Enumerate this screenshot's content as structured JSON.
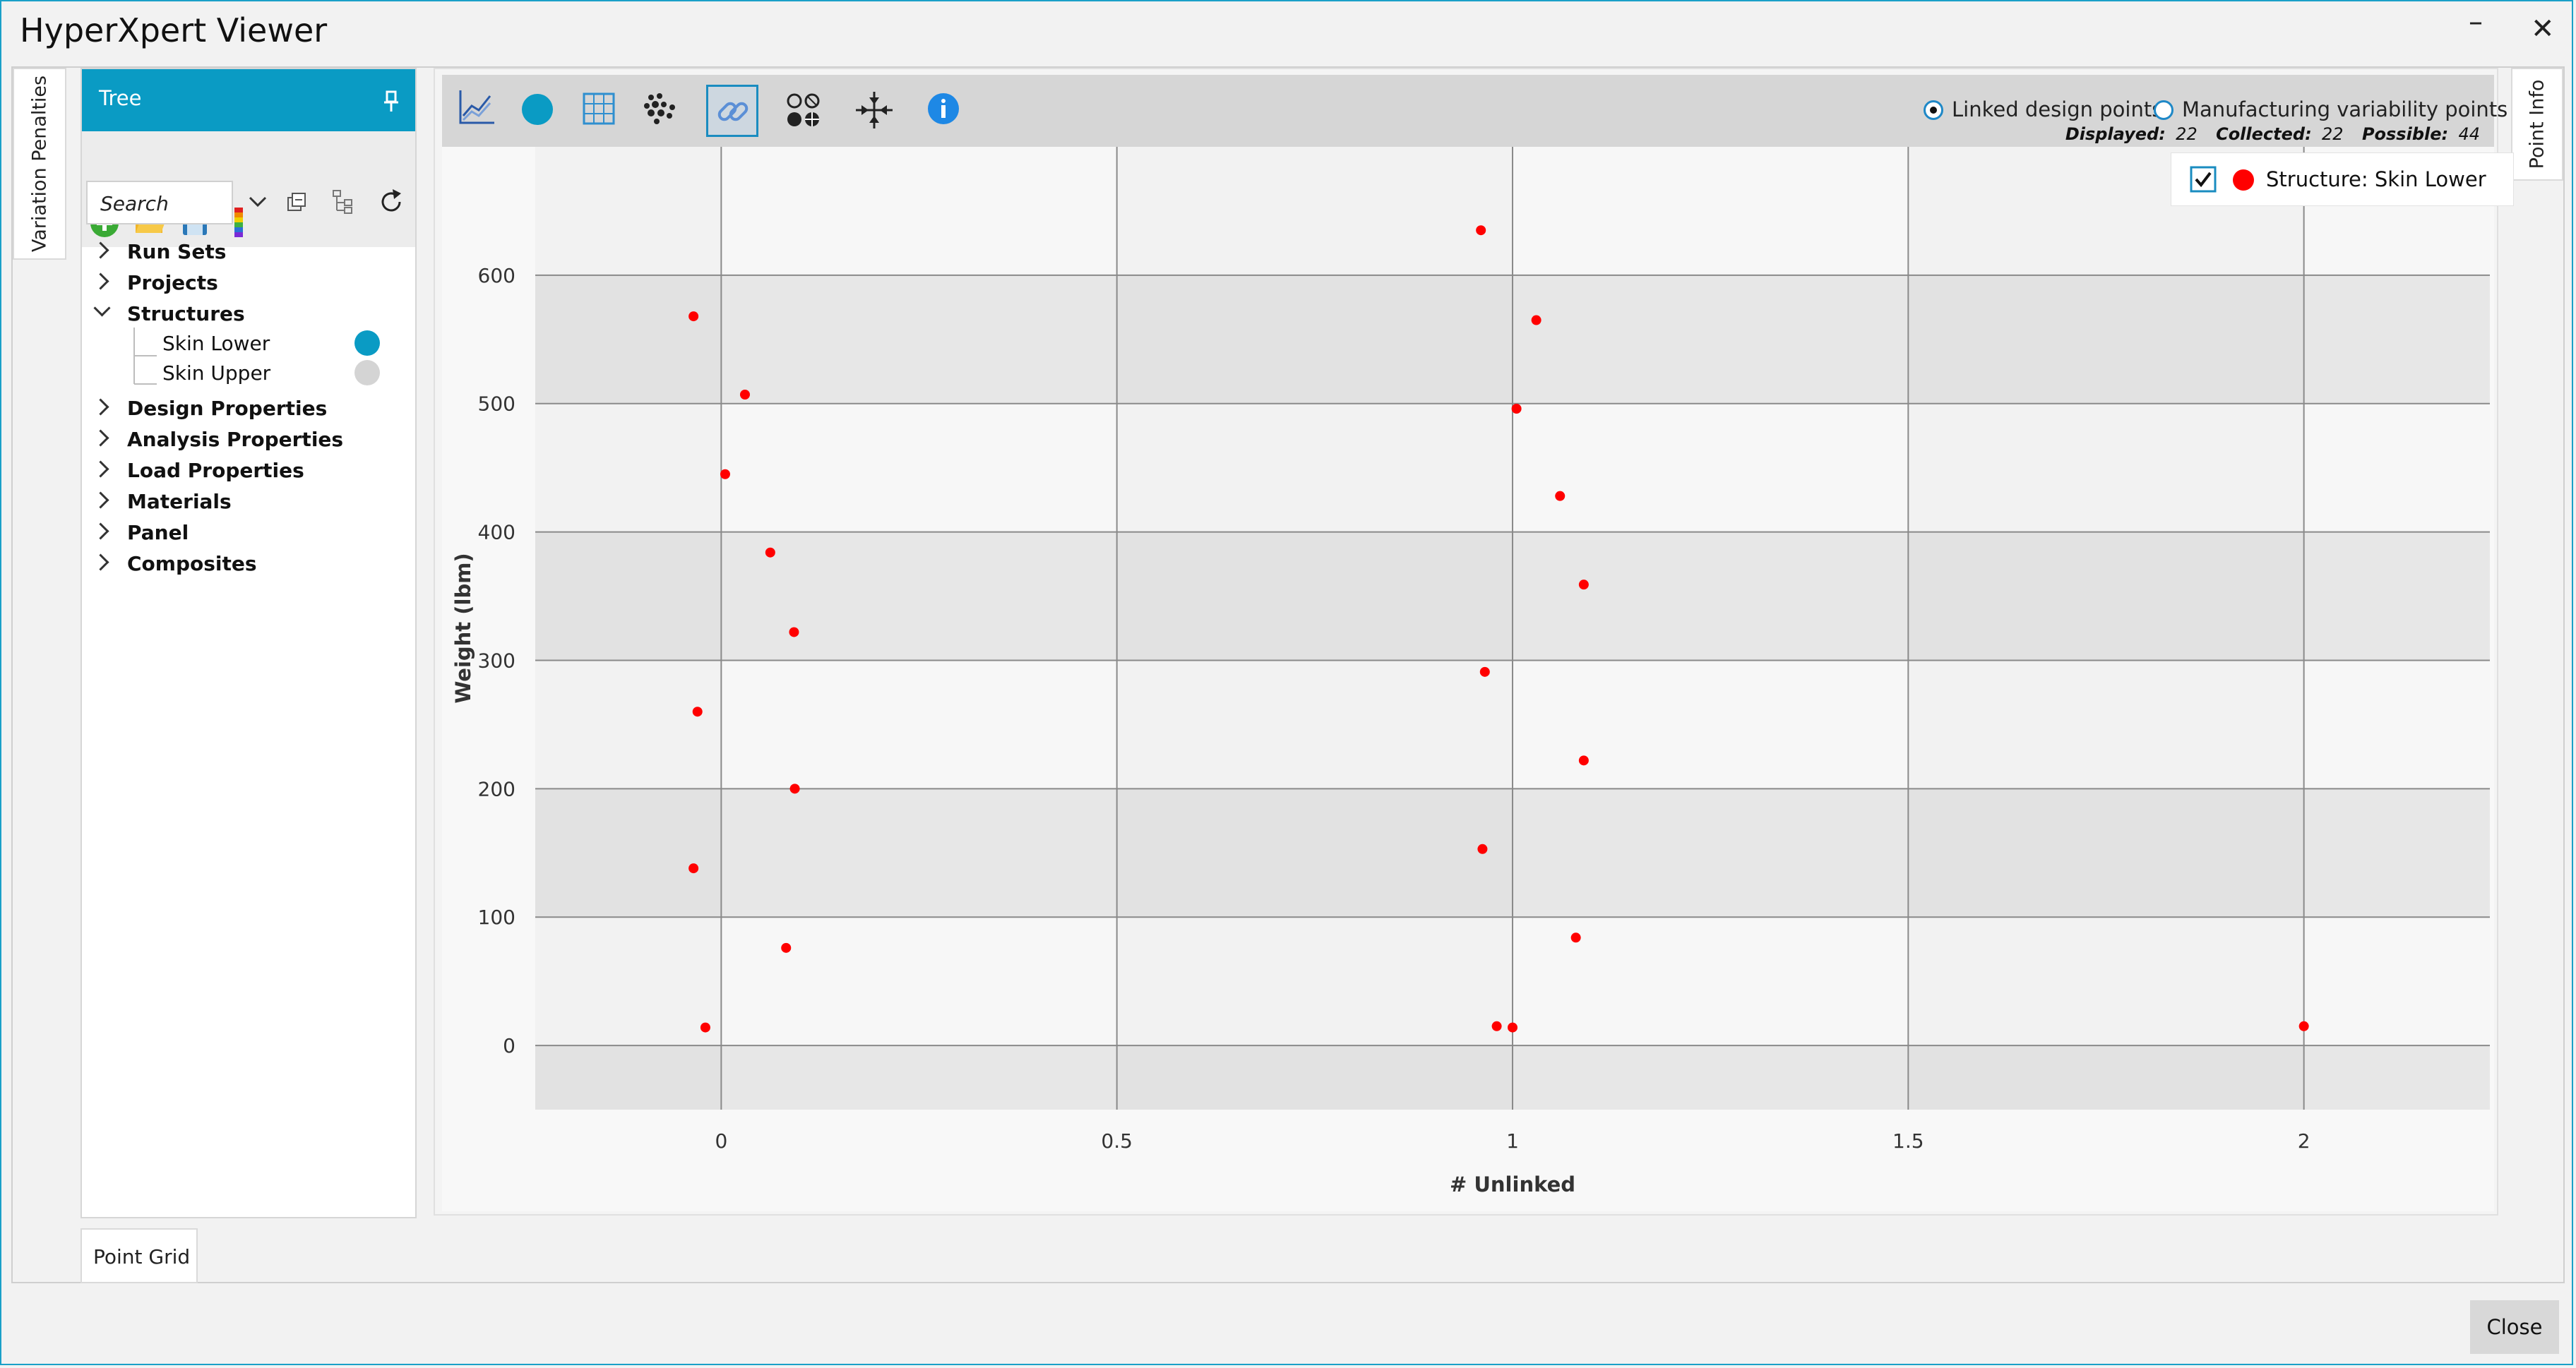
{
  "window": {
    "title": "HyperXpert Viewer",
    "minimize": "–",
    "close": "✕"
  },
  "side_tabs": {
    "left": "Variation Penalties",
    "right": "Point Info",
    "bottom": "Point Grid"
  },
  "tree": {
    "header": "Tree",
    "search_placeholder": "Search",
    "items": [
      {
        "label": "Run Sets",
        "expanded": false
      },
      {
        "label": "Projects",
        "expanded": false
      },
      {
        "label": "Structures",
        "expanded": true
      },
      {
        "label": "Skin Lower",
        "leaf": true,
        "color": "#0a9bc4"
      },
      {
        "label": "Skin Upper",
        "leaf": true,
        "color": "#d4d4d4"
      },
      {
        "label": "Design Properties",
        "expanded": false
      },
      {
        "label": "Analysis Properties",
        "expanded": false
      },
      {
        "label": "Load Properties",
        "expanded": false
      },
      {
        "label": "Materials",
        "expanded": false
      },
      {
        "label": "Panel",
        "expanded": false
      },
      {
        "label": "Composites",
        "expanded": false
      }
    ]
  },
  "chart_toolbar": {
    "icons": [
      "line-chart-icon",
      "circle-icon",
      "table-icon",
      "scatter-cloud-icon",
      "link-icon",
      "point-styles-icon",
      "move-arrows-icon",
      "info-icon"
    ],
    "radio_linked": "Linked design points",
    "radio_manufacturing": "Manufacturing variability points",
    "displayed_label": "Displayed:",
    "displayed_value": "22",
    "collected_label": "Collected:",
    "collected_value": "22",
    "possible_label": "Possible:",
    "possible_value": "44"
  },
  "legend": {
    "label": "Structure: Skin Lower",
    "checked": true,
    "color": "#ff0000"
  },
  "chart_data": {
    "type": "scatter",
    "title": "",
    "xlabel": "# Unlinked",
    "ylabel": "Weight (lbm)",
    "xlim": [
      -0.235,
      2.235
    ],
    "ylim": [
      -50,
      700
    ],
    "xticks": [
      0,
      0.5,
      1,
      1.5,
      2
    ],
    "xtick_labels": [
      "0",
      "0.5",
      "1",
      "1.5",
      "2"
    ],
    "yticks": [
      0,
      100,
      200,
      300,
      400,
      500,
      600
    ],
    "ytick_labels": [
      "0",
      "100",
      "200",
      "300",
      "400",
      "500",
      "600"
    ],
    "grid": true,
    "legend_position": "top-right",
    "series": [
      {
        "name": "Structure: Skin Lower",
        "color": "#ff0000",
        "points": [
          [
            -0.035,
            568
          ],
          [
            0.03,
            507
          ],
          [
            0.005,
            445
          ],
          [
            0.062,
            384
          ],
          [
            0.092,
            322
          ],
          [
            -0.03,
            260
          ],
          [
            0.093,
            200
          ],
          [
            -0.035,
            138
          ],
          [
            0.082,
            76
          ],
          [
            -0.02,
            14
          ],
          [
            0.96,
            635
          ],
          [
            1.03,
            565
          ],
          [
            1.005,
            496
          ],
          [
            1.06,
            428
          ],
          [
            1.09,
            359
          ],
          [
            0.965,
            291
          ],
          [
            1.09,
            222
          ],
          [
            0.962,
            153
          ],
          [
            1.08,
            84
          ],
          [
            0.98,
            15
          ],
          [
            1.0,
            14
          ],
          [
            2.0,
            15
          ]
        ]
      }
    ]
  },
  "footer": {
    "close_label": "Close"
  }
}
